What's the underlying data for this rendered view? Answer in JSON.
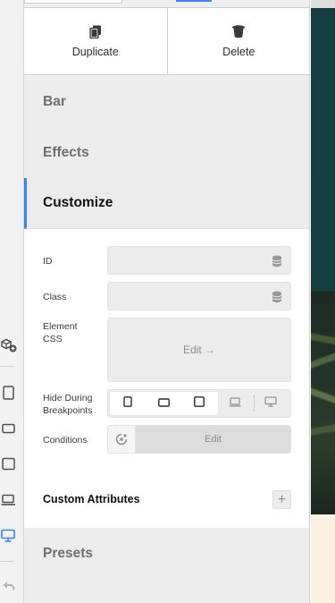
{
  "actions": {
    "duplicate_label": "Duplicate",
    "delete_label": "Delete"
  },
  "sections": {
    "bar": "Bar",
    "effects": "Effects",
    "customize": "Customize",
    "presets": "Presets"
  },
  "customize": {
    "id_label": "ID",
    "class_label": "Class",
    "element_css_label_line1": "Element",
    "element_css_label_line2": "CSS",
    "element_css_button": "Edit →",
    "hide_breakpoints_line1": "Hide During",
    "hide_breakpoints_line2": "Breakpoints",
    "conditions_label": "Conditions",
    "conditions_button": "Edit",
    "custom_attributes_label": "Custom Attributes",
    "add_symbol": "+"
  },
  "colors": {
    "accent": "#3b82f6",
    "canvas_teal": "#173f42",
    "canvas_cream": "#fdf1e3"
  },
  "icons": {
    "rail": [
      "add-element-icon",
      "phone-portrait-icon",
      "phone-landscape-icon",
      "tablet-icon",
      "laptop-icon",
      "desktop-icon",
      "undo-icon"
    ],
    "actions": [
      "duplicate-icon",
      "trash-icon"
    ],
    "fields": [
      "database-icon"
    ],
    "breakpoints": [
      "phone-portrait-icon",
      "phone-landscape-icon",
      "tablet-icon",
      "laptop-icon",
      "desktop-icon"
    ],
    "conditions": "dynamic-condition-icon"
  }
}
